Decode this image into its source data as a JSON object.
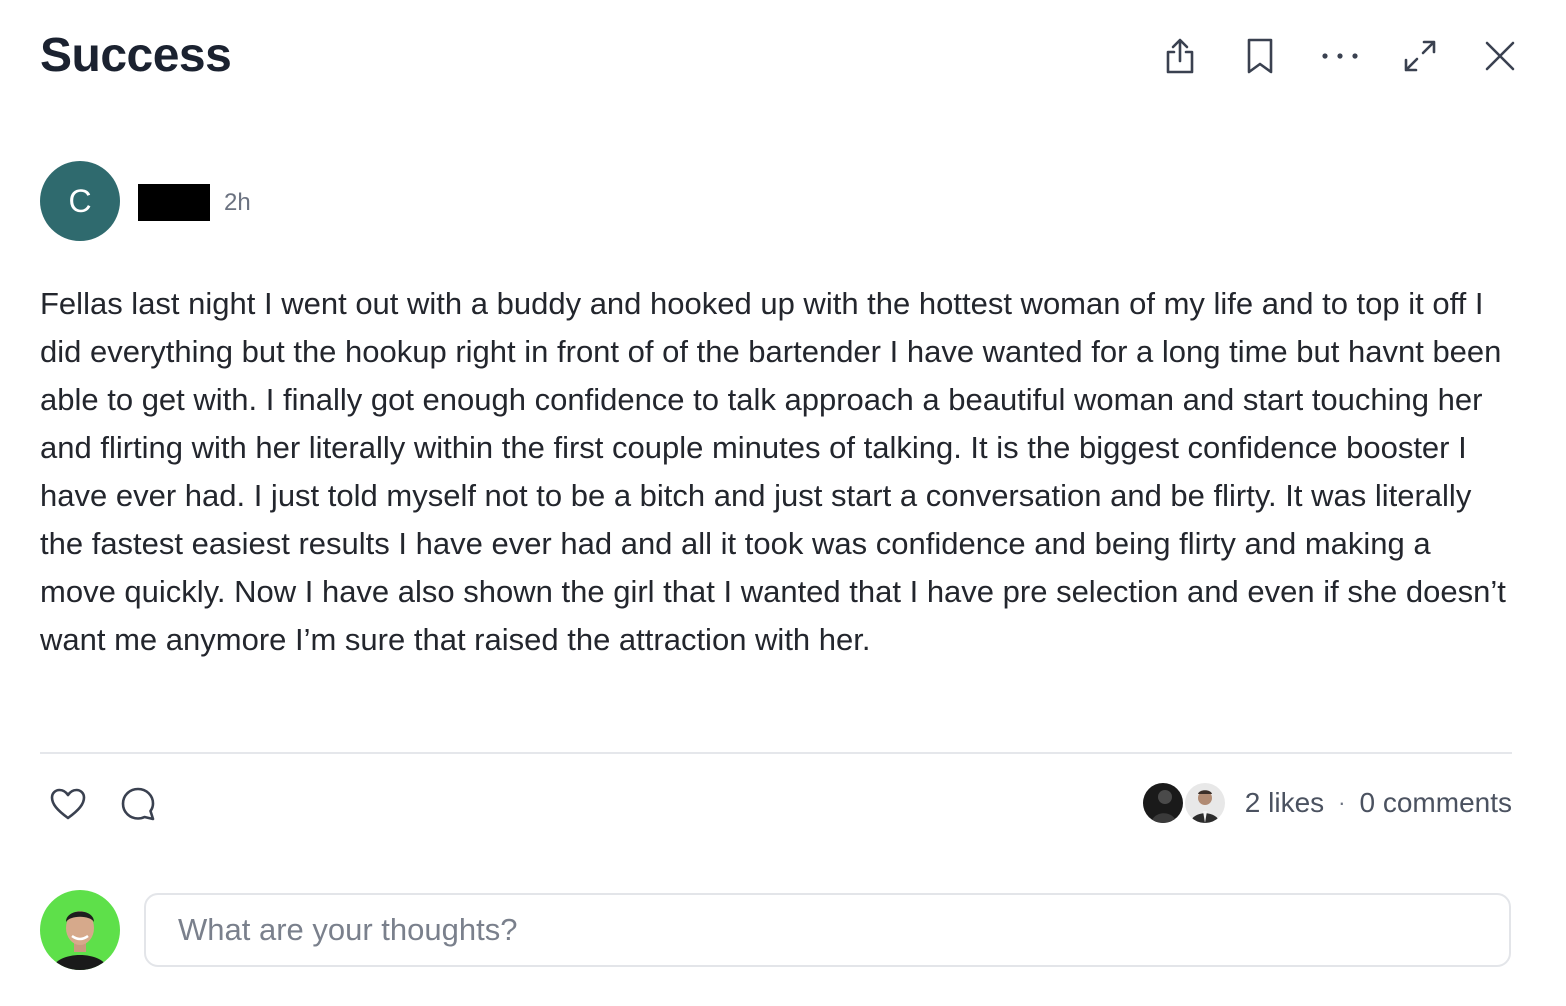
{
  "header": {
    "title": "Success"
  },
  "toolbar": {
    "share_icon": "share-icon",
    "bookmark_icon": "bookmark-icon",
    "more_icon": "more-icon",
    "expand_icon": "expand-icon",
    "close_icon": "close-icon"
  },
  "post": {
    "author_initial": "C",
    "author_avatar_color": "#2f6a6e",
    "time_ago": "2h",
    "body": "Fellas last night I went out with a buddy and hooked up with the hottest woman of my life and to top it off I did everything but the hookup right in front of of the bartender I have wanted for a long time but havnt been able to get with. I finally got enough confidence to talk approach a beautiful woman and start touching her and flirting with her literally within the first couple minutes of talking. It is the biggest confidence booster I have ever had. I just told myself not to be a bitch and just start a conversation and be flirty. It was literally the fastest easiest results I have ever had and all it took was confidence and being flirty and making a move quickly. Now I have also shown the girl that I wanted that I have pre selection and even if she doesn’t want me anymore I’m sure that raised the attraction with her."
  },
  "stats": {
    "likes": "2 likes",
    "separator": "·",
    "comments": "0 comments"
  },
  "composer": {
    "placeholder": "What are your thoughts?",
    "avatar_bg": "#5ee04a"
  }
}
